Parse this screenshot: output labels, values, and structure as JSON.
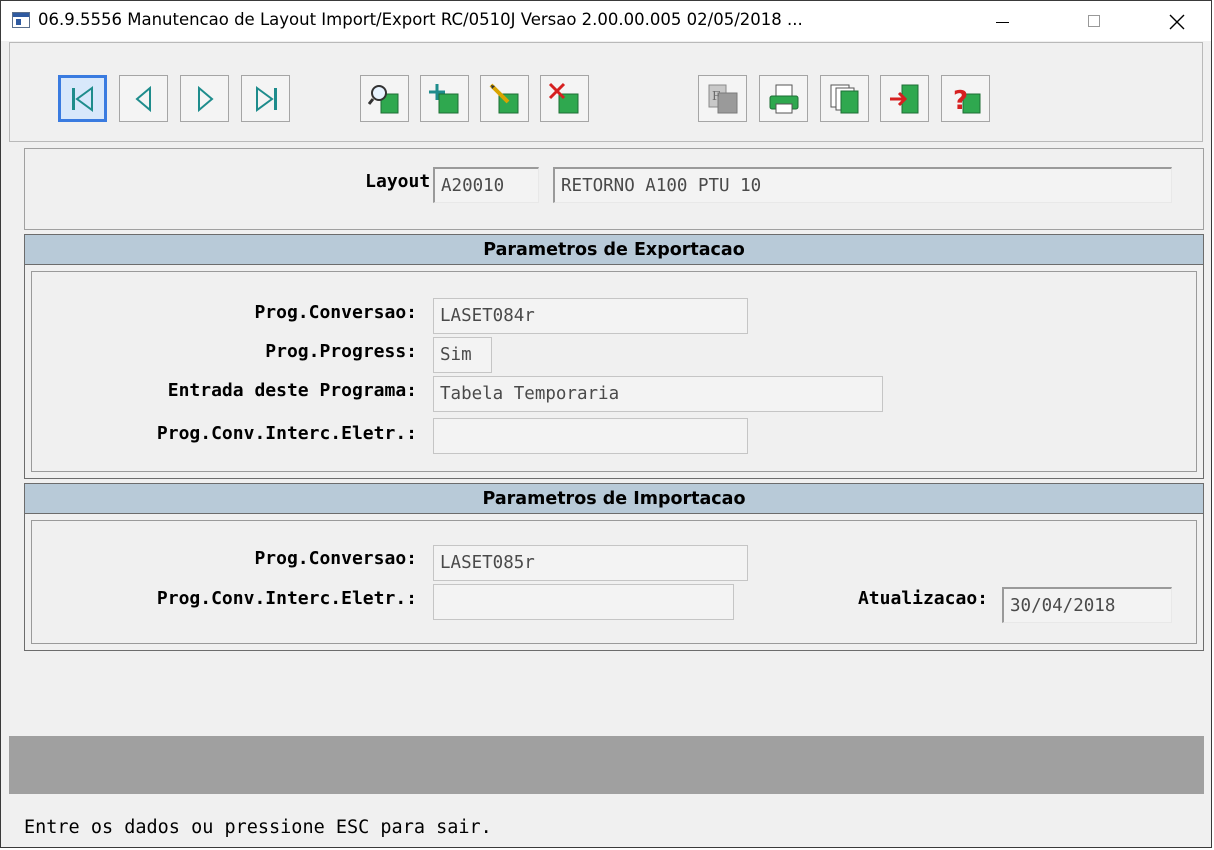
{
  "window": {
    "title": "06.9.5556 Manutencao  de Layout Import/Export RC/0510J Versao 2.00.00.005 02/05/2018 ..."
  },
  "toolbar": {
    "buttons": [
      {
        "name": "first-record-button",
        "icon": "first-icon"
      },
      {
        "name": "previous-record-button",
        "icon": "previous-icon"
      },
      {
        "name": "next-record-button",
        "icon": "next-icon"
      },
      {
        "name": "last-record-button",
        "icon": "last-icon"
      },
      {
        "name": "search-button",
        "icon": "search-icon"
      },
      {
        "name": "add-button",
        "icon": "add-icon"
      },
      {
        "name": "edit-button",
        "icon": "edit-icon"
      },
      {
        "name": "delete-button",
        "icon": "delete-icon"
      },
      {
        "name": "report-button",
        "icon": "report-icon"
      },
      {
        "name": "print-button",
        "icon": "print-icon"
      },
      {
        "name": "copy-button",
        "icon": "copy-icon"
      },
      {
        "name": "exit-button",
        "icon": "exit-icon"
      },
      {
        "name": "help-button",
        "icon": "help-icon"
      }
    ]
  },
  "layout": {
    "label": "Layout:",
    "code": "A20010",
    "description": "RETORNO A100 PTU 10"
  },
  "export": {
    "heading": "Parametros de Exportacao",
    "prog_conversao_label": "Prog.Conversao:",
    "prog_conversao": "LASET084r",
    "prog_progress_label": "Prog.Progress:",
    "prog_progress": "Sim",
    "entrada_label": "Entrada deste Programa:",
    "entrada": "Tabela Temporaria",
    "prog_conv_interc_label": "Prog.Conv.Interc.Eletr.:",
    "prog_conv_interc": ""
  },
  "import": {
    "heading": "Parametros de Importacao",
    "prog_conversao_label": "Prog.Conversao:",
    "prog_conversao": "LASET085r",
    "prog_conv_interc_label": "Prog.Conv.Interc.Eletr.:",
    "prog_conv_interc": "",
    "atualizacao_label": "Atualizacao:",
    "atualizacao": "30/04/2018"
  },
  "status": {
    "message": "Entre os dados ou pressione ESC para sair."
  },
  "colors": {
    "section_header": "#b8cad8",
    "selected_button_border": "#3a7be0",
    "icon_green": "#2fa84f",
    "icon_teal": "#1e8c8c"
  }
}
